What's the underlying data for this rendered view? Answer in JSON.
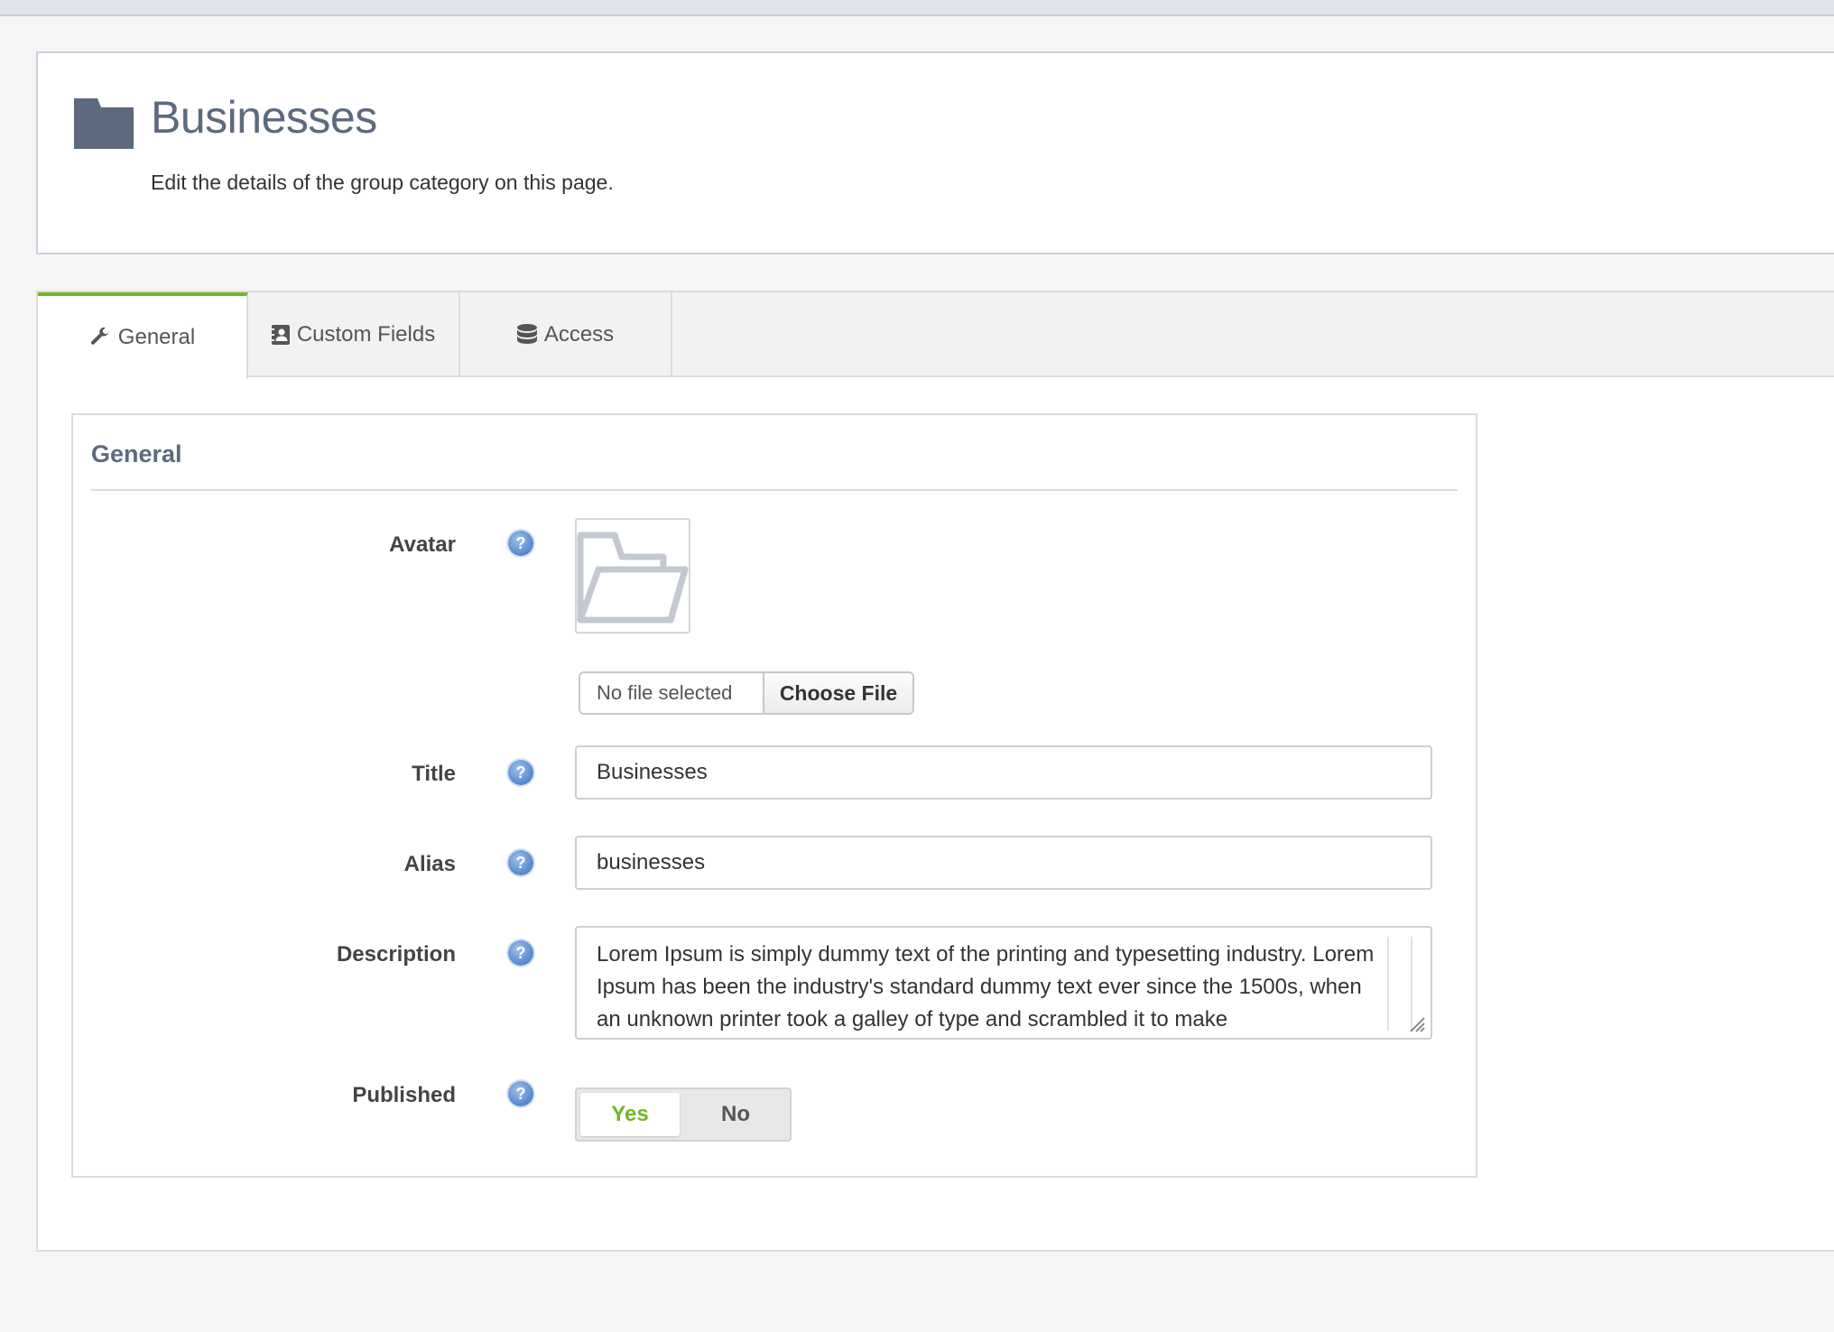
{
  "header": {
    "title": "Businesses",
    "subtitle": "Edit the details of the group category on this page."
  },
  "tabs": [
    {
      "label": "General",
      "icon": "wrench-icon",
      "active": true
    },
    {
      "label": "Custom Fields",
      "icon": "contact-card-icon",
      "active": false
    },
    {
      "label": "Access",
      "icon": "database-icon",
      "active": false
    }
  ],
  "panel": {
    "title": "General"
  },
  "fields": {
    "avatar": {
      "label": "Avatar",
      "file_status": "No file selected",
      "file_button": "Choose File"
    },
    "title": {
      "label": "Title",
      "value": "Businesses"
    },
    "alias": {
      "label": "Alias",
      "value": "businesses"
    },
    "description": {
      "label": "Description",
      "value": "Lorem Ipsum is simply dummy text of the printing and typesetting industry. Lorem Ipsum has been the industry's standard dummy text ever since the 1500s, when an unknown printer took a galley of type and scrambled it to make"
    },
    "published": {
      "label": "Published",
      "yes": "Yes",
      "no": "No",
      "selected": "Yes"
    }
  },
  "colors": {
    "accent_green": "#72b626",
    "title_slate": "#5d6a7e",
    "help_blue": "#5f8fd0"
  }
}
